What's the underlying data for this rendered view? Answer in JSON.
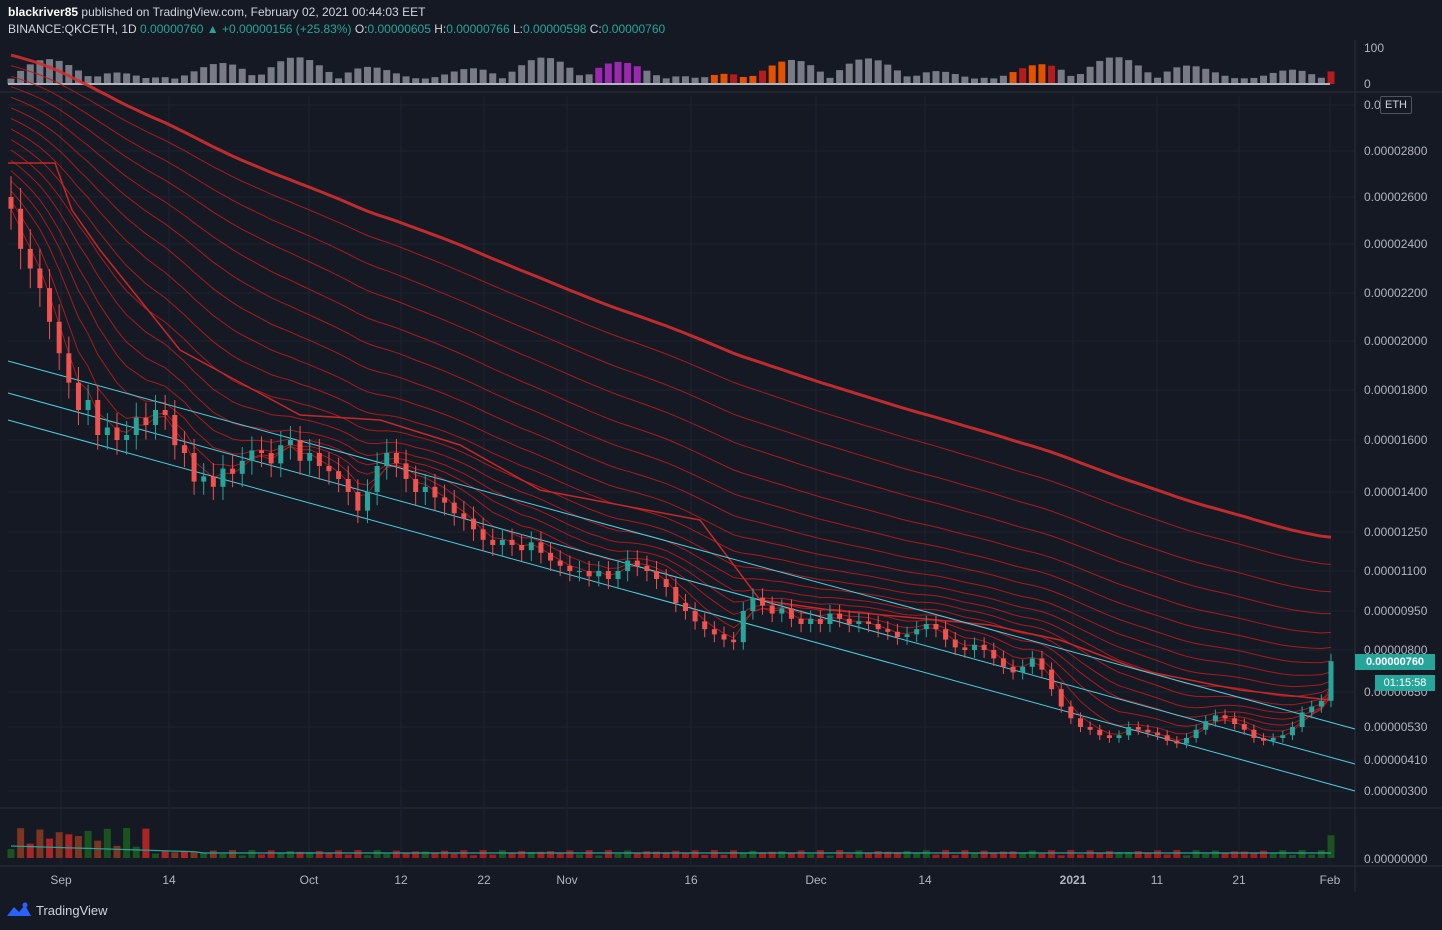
{
  "header": {
    "publisher": "blackriver85",
    "published_text": "published on TradingView.com, February 02, 2021 00:44:03 EET",
    "symbol": "BINANCE:QKCETH, 1D",
    "last": "0.00000760",
    "change_arrow": "▲",
    "change": "+0.00000156 (+25.83%)",
    "o_label": "O:",
    "o_value": "0.00000605",
    "h_label": "H:",
    "h_value": "0.00000766",
    "l_label": "L:",
    "l_value": "0.00000598",
    "c_label": "C:",
    "c_value": "0.00000760"
  },
  "price_tag": "0.00000760",
  "timer_tag": "01:15:58",
  "currency_badge": "ETH",
  "footer": {
    "brand": "TradingView",
    "logo_icon": "tradingview-logo-icon"
  },
  "colors": {
    "background": "#151924",
    "up": "#26a69a",
    "down": "#ef5350",
    "ribbon": "#c62828",
    "channel": "#4dd0e1"
  },
  "chart_data": {
    "type": "candlestick",
    "price_axis_labels": [
      "0.0000",
      "0.00002800",
      "0.00002600",
      "0.00002400",
      "0.00002200",
      "0.00002000",
      "0.00001800",
      "0.00001600",
      "0.00001400",
      "0.00001250",
      "0.00001100",
      "0.00000950",
      "0.00000800",
      "0.00000650",
      "0.00000530",
      "0.00000410",
      "0.00000300"
    ],
    "top_pane_axis_labels": [
      "100",
      "0"
    ],
    "volume_axis_label": "0.00000000",
    "time_axis_labels": [
      "Sep",
      "14",
      "Oct",
      "12",
      "22",
      "Nov",
      "16",
      "Dec",
      "14",
      "2021",
      "11",
      "21",
      "Feb"
    ],
    "indicators": [
      "EMA ribbon",
      "descending channel",
      "TD sequential counts",
      "oscillator histogram",
      "volume"
    ],
    "close_series": [
      2.55,
      2.38,
      2.3,
      2.22,
      2.08,
      1.95,
      1.83,
      1.72,
      1.76,
      1.62,
      1.65,
      1.6,
      1.62,
      1.69,
      1.66,
      1.72,
      1.7,
      1.58,
      1.55,
      1.44,
      1.46,
      1.42,
      1.49,
      1.47,
      1.52,
      1.56,
      1.55,
      1.51,
      1.58,
      1.6,
      1.52,
      1.55,
      1.5,
      1.48,
      1.45,
      1.4,
      1.33,
      1.4,
      1.5,
      1.55,
      1.51,
      1.45,
      1.4,
      1.42,
      1.38,
      1.36,
      1.32,
      1.3,
      1.26,
      1.22,
      1.2,
      1.22,
      1.2,
      1.18,
      1.21,
      1.17,
      1.14,
      1.12,
      1.1,
      1.1,
      1.08,
      1.1,
      1.07,
      1.1,
      1.14,
      1.12,
      1.1,
      1.07,
      1.04,
      0.98,
      0.95,
      0.91,
      0.88,
      0.86,
      0.84,
      0.83,
      0.95,
      1.0,
      0.97,
      0.94,
      0.96,
      0.92,
      0.9,
      0.92,
      0.9,
      0.94,
      0.92,
      0.9,
      0.91,
      0.9,
      0.88,
      0.87,
      0.85,
      0.86,
      0.88,
      0.9,
      0.88,
      0.84,
      0.81,
      0.8,
      0.82,
      0.8,
      0.77,
      0.74,
      0.72,
      0.74,
      0.77,
      0.73,
      0.66,
      0.6,
      0.56,
      0.53,
      0.52,
      0.5,
      0.49,
      0.5,
      0.53,
      0.52,
      0.51,
      0.5,
      0.48,
      0.47,
      0.49,
      0.52,
      0.55,
      0.57,
      0.56,
      0.54,
      0.52,
      0.49,
      0.48,
      0.49,
      0.5,
      0.53,
      0.58,
      0.6,
      0.62,
      0.76
    ]
  }
}
